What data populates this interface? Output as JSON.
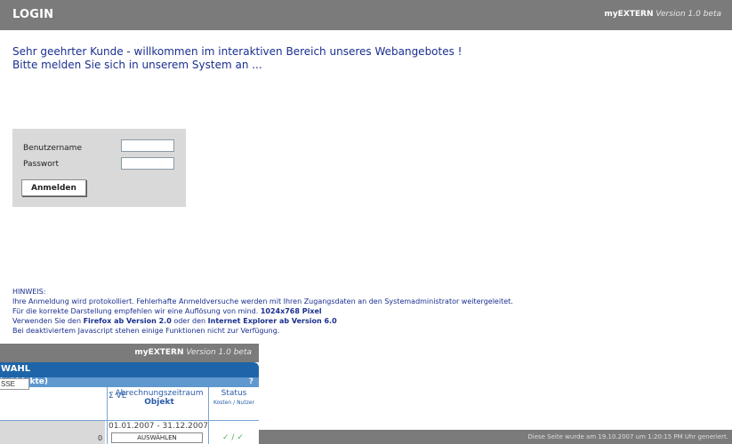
{
  "header": {
    "title": "LOGIN",
    "brand": "myEXTERN",
    "version": "Version 1.0 beta"
  },
  "welcome": {
    "line1": "Sehr geehrter Kunde - willkommen im interaktiven Bereich unseres Webangebotes !",
    "line2": "Bitte melden Sie sich in unserem System an ..."
  },
  "login": {
    "username_label": "Benutzername",
    "password_label": "Passwort",
    "username_value": "",
    "password_value": "",
    "submit_label": "Anmelden"
  },
  "hint": {
    "title": "HINWEIS:",
    "line1": "Ihre Anmeldung wird protokolliert. Fehlerhafte Anmeldversuche werden mit Ihren Zugangsdaten an den Systemadministrator weitergeleitet.",
    "line2_pre": "Für die korrekte Darstellung empfehlen wir eine Auflösung von mind. ",
    "line2_bold": "1024x768 Pixel",
    "line3_pre": "Verwenden Sie den ",
    "line3_bold1": "Firefox ab Version 2.0",
    "line3_mid": " oder den ",
    "line3_bold2": "Internet Explorer ab Version 6.0",
    "line4": "Bei deaktiviertem Javascript stehen einige Funktionen nicht zur Verfügung."
  },
  "footer": {
    "generated": "Diese Seite wurde am 19.10.2007 um 1:20:15 PM Uhr generiert."
  },
  "fragment": {
    "brand": "myEXTERN",
    "version": "Version 1.0 beta",
    "panel_title": "WAHL",
    "subhead": "b-Objekte)",
    "help": "?",
    "klasse_input": "SSE",
    "col_ve": "Σ VE",
    "col_period": "Abrechnungszeitraum",
    "col_object": "Objekt",
    "col_status": "Status",
    "col_status_sub": "Kosten / Nutzer",
    "row_ve": "0",
    "row_period": "01.01.2007 - 31.12.2007",
    "row_button": "AUSWÄHLEN",
    "row_checks": "✓ / ✓"
  },
  "colors": {
    "bar": "#7b7b7b",
    "text_blue": "#1a2f8f",
    "panel_blue": "#1e64a8"
  }
}
